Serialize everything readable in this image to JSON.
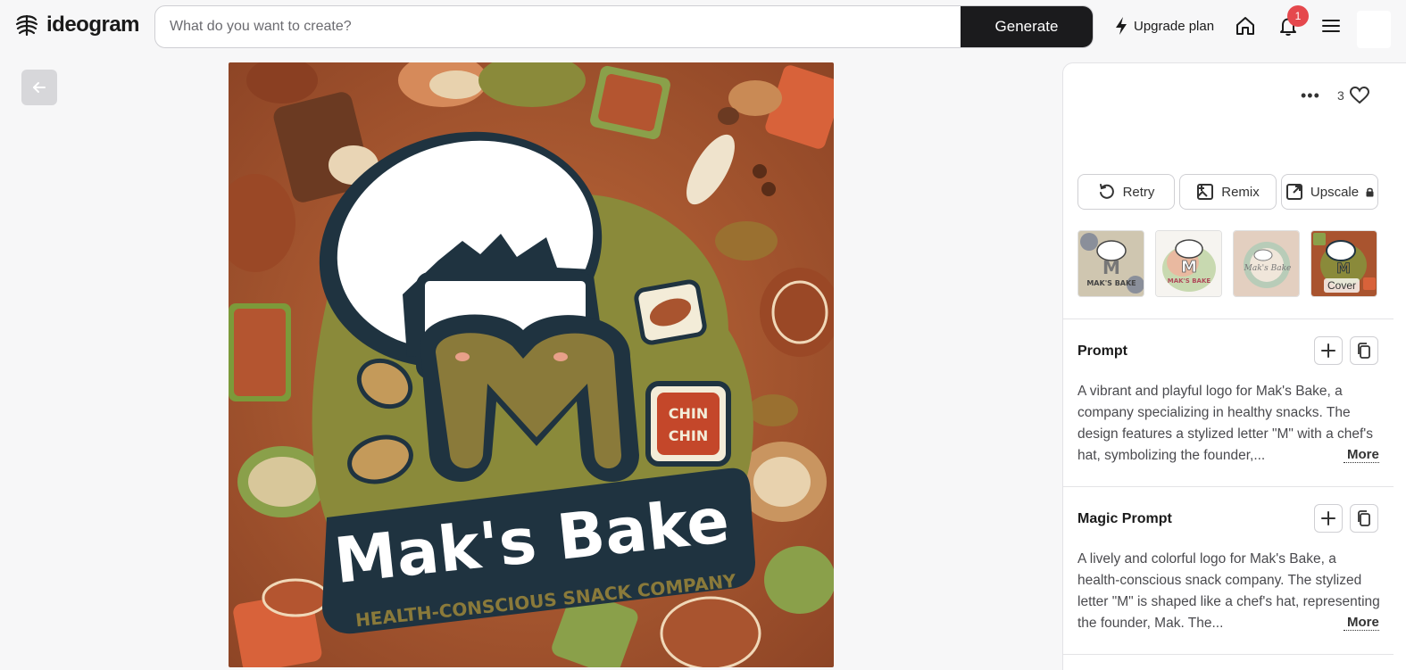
{
  "header": {
    "logo_text": "ideogram",
    "search_placeholder": "What do you want to create?",
    "generate_label": "Generate",
    "upgrade_label": "Upgrade plan",
    "notification_count": "1"
  },
  "artwork": {
    "brand_name": "Mak's Bake",
    "tagline": "HEALTH-CONSCIOUS SNACK COMPANY",
    "sign_text_1": "CHIN",
    "sign_text_2": "CHIN",
    "letter": "M"
  },
  "panel": {
    "like_count": "3",
    "actions": {
      "retry": "Retry",
      "remix": "Remix",
      "upscale": "Upscale"
    },
    "thumbnails": {
      "thumb1_text": "MAK'S BAKE",
      "thumb2_text": "MAK'S BAKE",
      "thumb3_text": "Mak's Bake",
      "cover_label": "Cover"
    },
    "prompt": {
      "title": "Prompt",
      "text": "A vibrant and playful logo for Mak's Bake, a company specializing in healthy snacks. The design features a stylized letter \"M\" with a chef's hat, symbolizing the founder,...",
      "more_label": "More"
    },
    "magic_prompt": {
      "title": "Magic Prompt",
      "text": "A lively and colorful logo for Mak's Bake, a health-conscious snack company. The stylized letter \"M\" is shaped like a chef's hat, representing the founder, Mak. The...",
      "more_label": "More"
    }
  },
  "colors": {
    "accent_dark": "#1b1b1d",
    "badge_red": "#e5484d",
    "art_background": "#a9542f",
    "art_olive": "#8a8a3a",
    "art_navy": "#1f3340"
  }
}
